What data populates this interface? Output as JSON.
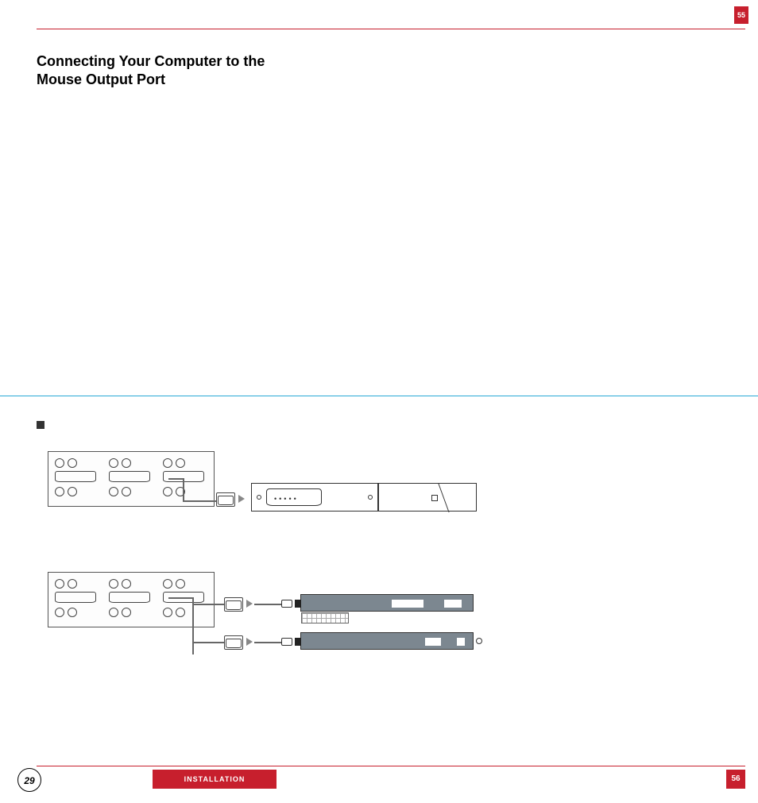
{
  "page_numbers": {
    "top_tab": "55",
    "bottom_right": "56",
    "bottom_left_circle": "29"
  },
  "heading": "Connecting Your Computer to the Mouse Output Port",
  "footer_label": "INSTALLATION"
}
